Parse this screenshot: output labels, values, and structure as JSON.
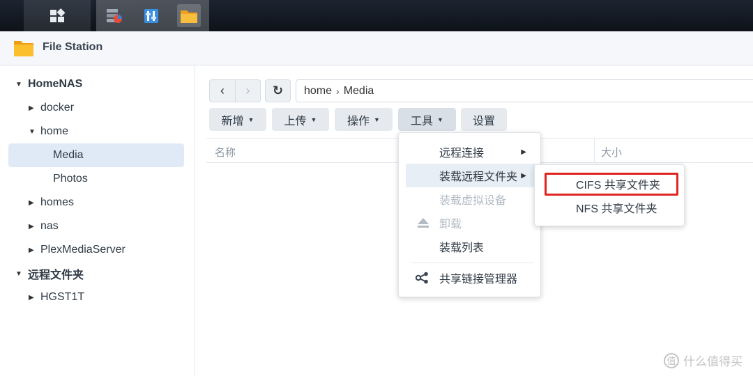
{
  "window": {
    "title": "File Station"
  },
  "sidebar": {
    "items": [
      {
        "label": "HomeNAS",
        "caret": "▼"
      },
      {
        "label": "docker",
        "caret": "▶"
      },
      {
        "label": "home",
        "caret": "▼"
      },
      {
        "label": "Media",
        "caret": ""
      },
      {
        "label": "Photos",
        "caret": ""
      },
      {
        "label": "homes",
        "caret": "▶"
      },
      {
        "label": "nas",
        "caret": "▶"
      },
      {
        "label": "PlexMediaServer",
        "caret": "▶"
      },
      {
        "label": "远程文件夹",
        "caret": "▼"
      },
      {
        "label": "HGST1T",
        "caret": "▶"
      }
    ]
  },
  "path": {
    "segments": [
      "home",
      "Media"
    ],
    "separator": "›"
  },
  "toolbar": {
    "create": "新增",
    "upload": "上传",
    "action": "操作",
    "tools": "工具",
    "settings": "设置"
  },
  "columns": {
    "name": "名称",
    "size": "大小"
  },
  "tools_menu": {
    "remote_connect": "远程连接",
    "mount_remote_folder": "装载远程文件夹",
    "mount_virtual_drive": "装载虚拟设备",
    "unmount": "卸载",
    "mount_list": "装载列表",
    "share_link_manager": "共享链接管理器"
  },
  "submenu": {
    "cifs": "CIFS 共享文件夹",
    "nfs": "NFS 共享文件夹"
  },
  "watermark": {
    "text": "什么值得买",
    "icon": "值"
  },
  "colors": {
    "highlight": "#e0241f",
    "folder": "#f5a623",
    "selected_bg": "#dfeaf6"
  }
}
